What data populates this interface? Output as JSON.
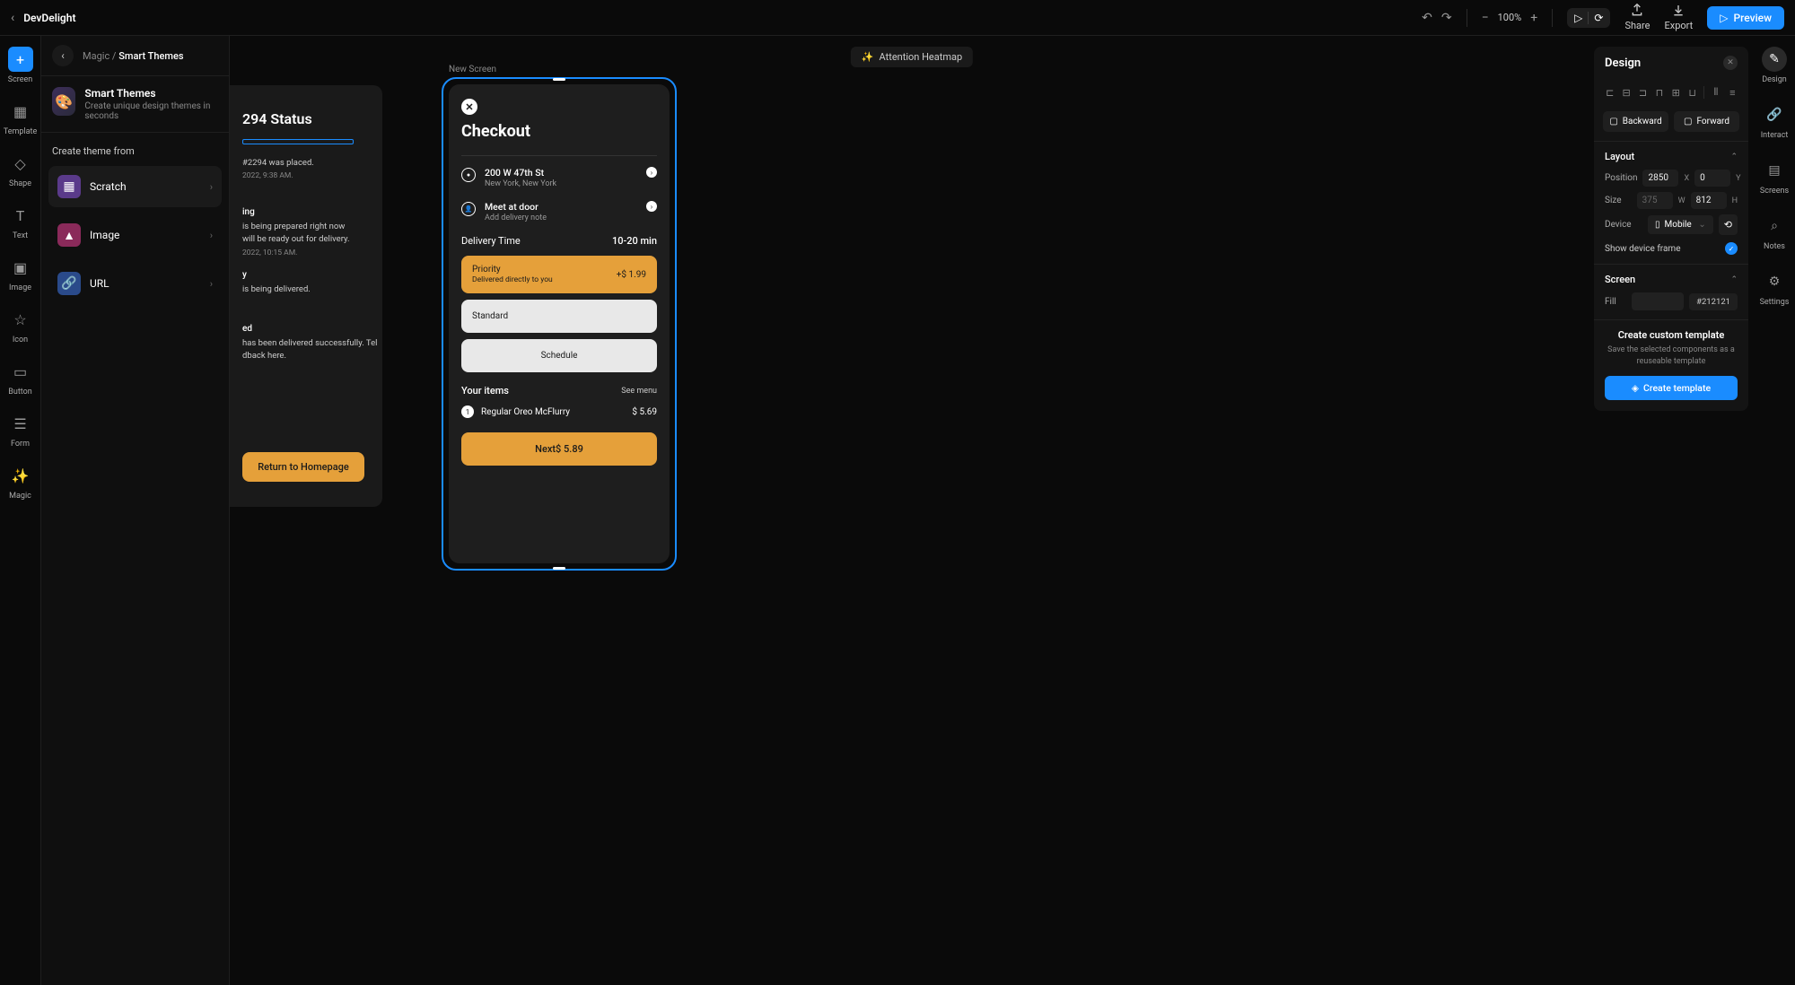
{
  "brand": "DevDelight",
  "zoom": "100%",
  "topbar": {
    "share": "Share",
    "export": "Export",
    "preview": "Preview",
    "heatmap": "Attention Heatmap"
  },
  "tools": {
    "screen": "Screen",
    "template": "Template",
    "shape": "Shape",
    "text": "Text",
    "image": "Image",
    "icon": "Icon",
    "button": "Button",
    "form": "Form",
    "magic": "Magic"
  },
  "themes_panel": {
    "breadcrumb_parent": "Magic",
    "breadcrumb_current": "Smart Themes",
    "title": "Smart Themes",
    "subtitle": "Create unique design themes in seconds",
    "section_heading": "Create theme from",
    "options": {
      "scratch": "Scratch",
      "image": "Image",
      "url": "URL"
    }
  },
  "canvas": {
    "new_screen_label": "New Screen"
  },
  "screen1": {
    "title": "294 Status",
    "b1_line1": "#2294 was placed.",
    "b1_time": "2022, 9:38 AM.",
    "b2_head": "ing",
    "b2_line1": "is being prepared right now",
    "b2_line2": "will be ready out for delivery.",
    "b2_time": "2022, 10:15 AM.",
    "b3_head": "y",
    "b3_line1": "is being delivered.",
    "b4_head": "ed",
    "b4_line1": "has been delivered successfully. Tel",
    "b4_line2": "dback here.",
    "return": "Return to Homepage"
  },
  "screen2": {
    "title": "Checkout",
    "addr_main": "200 W 47th St",
    "addr_sub": "New York, New York",
    "meet_main": "Meet at door",
    "meet_sub": "Add delivery note",
    "delivery_label": "Delivery Time",
    "eta": "10-20 min",
    "priority_label": "Priority",
    "priority_sub": "Delivered directly to you",
    "priority_extra": "+$ 1.99",
    "standard": "Standard",
    "schedule": "Schedule",
    "items_title": "Your items",
    "see_menu": "See menu",
    "item1_name": "Regular Oreo McFlurry",
    "item1_price": "$ 5.69",
    "next_label": "Next",
    "next_price": "$ 5.89"
  },
  "inspector": {
    "title": "Design",
    "backward": "Backward",
    "forward": "Forward",
    "layout": "Layout",
    "position": "Position",
    "pos_x": "2850",
    "pos_y": "0",
    "x_label": "X",
    "y_label": "Y",
    "size": "Size",
    "size_w": "375",
    "size_h": "812",
    "w_label": "W",
    "h_label": "H",
    "device": "Device",
    "device_value": "Mobile",
    "show_frame": "Show device frame",
    "screen_section": "Screen",
    "fill": "Fill",
    "fill_hex": "#212121",
    "template_title": "Create custom template",
    "template_sub": "Save the selected components as a reuseable template",
    "template_btn": "Create template"
  },
  "right_rail": {
    "design": "Design",
    "interact": "Interact",
    "screens": "Screens",
    "notes": "Notes",
    "settings": "Settings"
  }
}
